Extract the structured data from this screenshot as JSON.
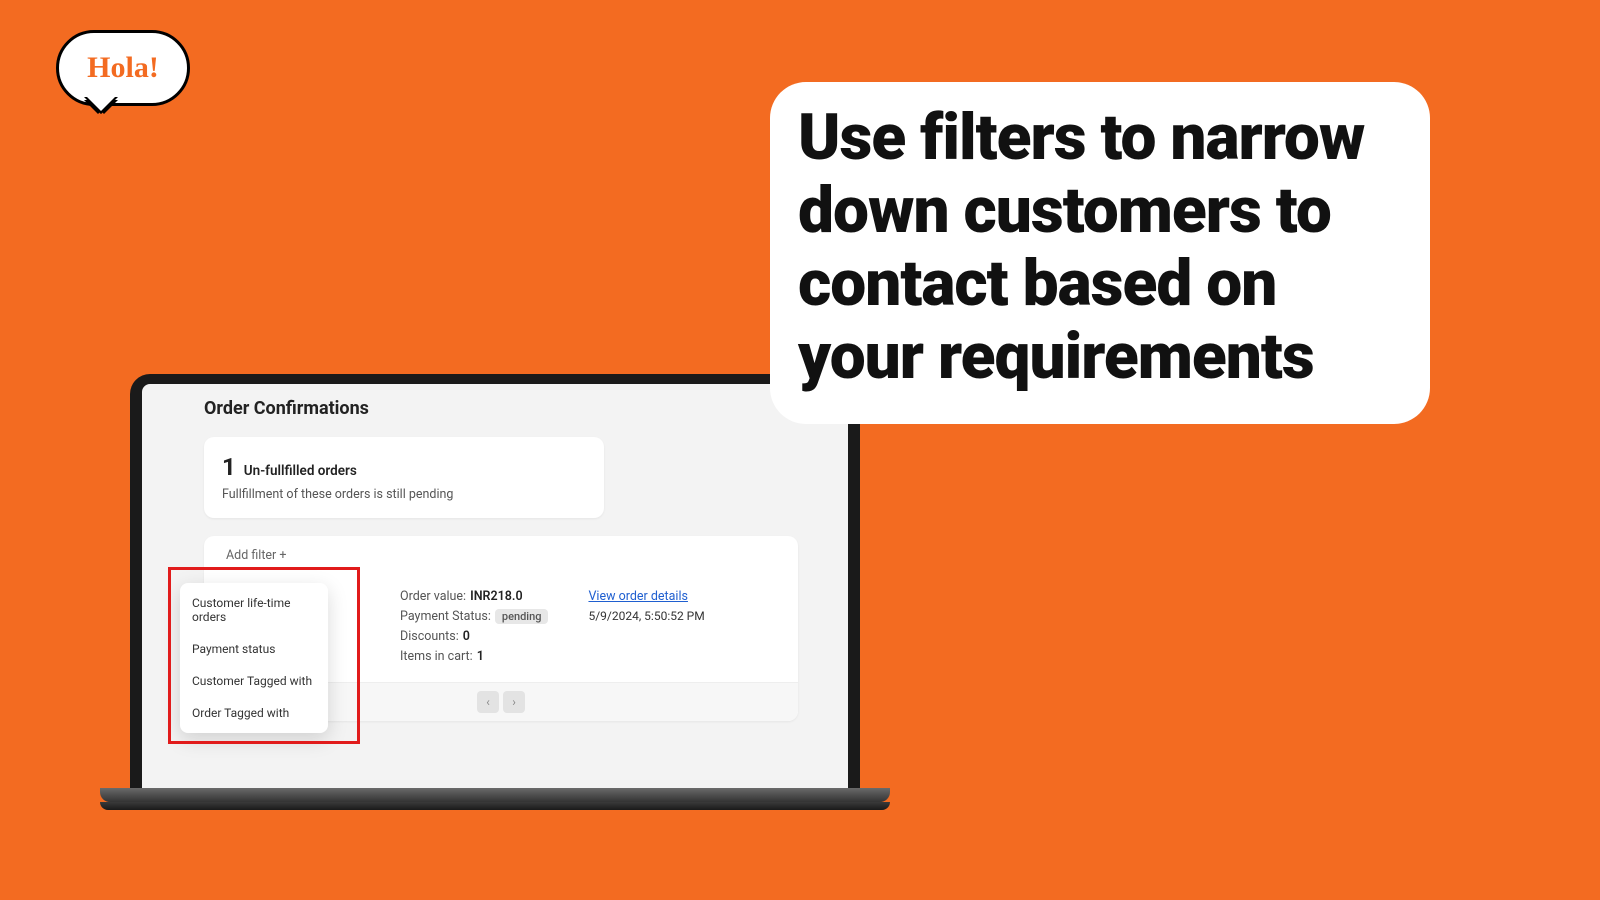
{
  "bubble": {
    "text": "Hola!"
  },
  "headline": "Use filters to narrow down customers to contact based on your requirements",
  "page": {
    "title": "Order Confirmations",
    "summary": {
      "count": "1",
      "label": "Un-fullfilled orders",
      "sub": "Fullfillment of these orders is still pending"
    },
    "addFilterLabel": "Add filter +",
    "filterOptions": [
      "Customer life-time orders",
      "Payment status",
      "Customer Tagged with",
      "Order Tagged with"
    ],
    "order": {
      "valueLabel": "Order value:",
      "value": "INR218.0",
      "paymentLabel": "Payment Status:",
      "paymentBadge": "pending",
      "discountsLabel": "Discounts:",
      "discounts": "0",
      "itemsLabel": "Items in cart:",
      "items": "1",
      "detailsLink": "View order details",
      "timestamp": "5/9/2024, 5:50:52 PM"
    },
    "paginator": {
      "prev": "‹",
      "next": "›"
    }
  }
}
